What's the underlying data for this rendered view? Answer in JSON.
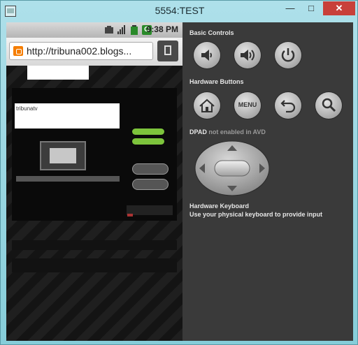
{
  "window": {
    "title": "5554:TEST",
    "min_label": "—",
    "max_label": "□",
    "close_label": "✕"
  },
  "status": {
    "time": "9:38 PM",
    "tile_g": "G"
  },
  "browser": {
    "url": "http://tribuna002.blogs..."
  },
  "controls": {
    "basic_label": "Basic Controls",
    "hardware_label": "Hardware Buttons",
    "menu_label": "MENU",
    "dpad_label": "DPAD",
    "dpad_note": "not enabled in AVD",
    "keyboard_title": "Hardware Keyboard",
    "keyboard_desc": "Use your physical keyboard to provide input"
  },
  "page": {
    "blog_title": "tribunatv"
  },
  "colors": {
    "accent": "#7dc43c",
    "close": "#c8403a",
    "panel": "#3a3a3a"
  }
}
